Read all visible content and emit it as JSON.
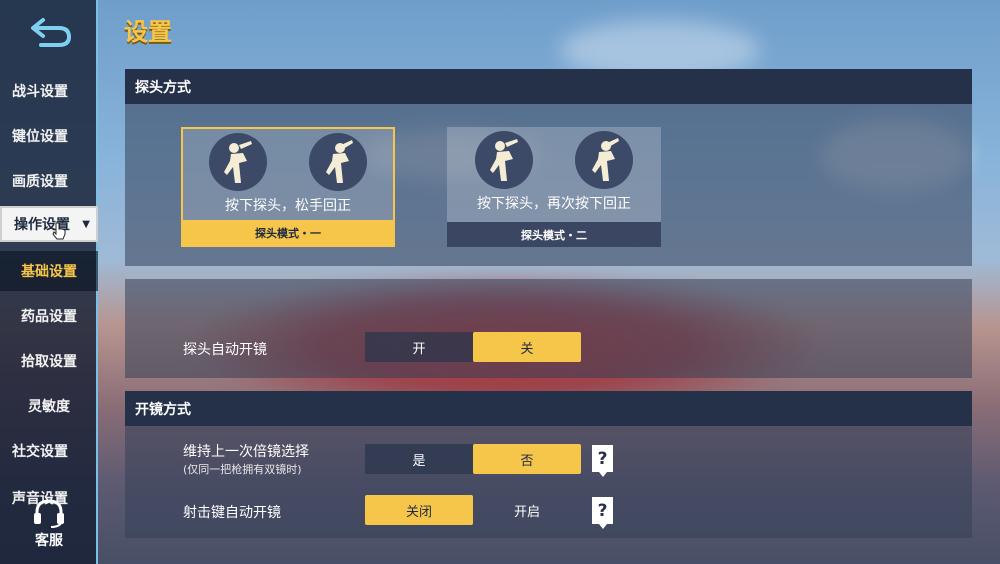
{
  "sidebar": {
    "items": [
      {
        "label": "战斗设置"
      },
      {
        "label": "键位设置"
      },
      {
        "label": "画质设置"
      },
      {
        "label": "操作设置"
      },
      {
        "label": "基础设置"
      },
      {
        "label": "药品设置"
      },
      {
        "label": "拾取设置"
      },
      {
        "label": "灵敏度"
      },
      {
        "label": "社交设置"
      },
      {
        "label": "声音设置"
      }
    ],
    "service_label": "客服"
  },
  "page": {
    "title": "设置"
  },
  "peek": {
    "header": "探头方式",
    "modes": [
      {
        "desc": "按下探头，松手回正",
        "footer": "探头模式・一",
        "selected": true
      },
      {
        "desc": "按下探头，再次按下回正",
        "footer": "探头模式・二",
        "selected": false
      }
    ],
    "auto_scope": {
      "label": "探头自动开镜",
      "options": [
        "开",
        "关"
      ],
      "selected": "关"
    }
  },
  "scope": {
    "header": "开镜方式",
    "keep_last": {
      "label": "维持上一次倍镜选择",
      "sublabel": "(仅同一把枪拥有双镜时)",
      "options": [
        "是",
        "否"
      ],
      "selected": "否"
    },
    "fire_auto": {
      "label": "射击键自动开镜",
      "options": [
        "关闭",
        "开启"
      ],
      "selected": "关闭"
    }
  },
  "colors": {
    "accent": "#f6c64a",
    "panel": "#253149"
  }
}
